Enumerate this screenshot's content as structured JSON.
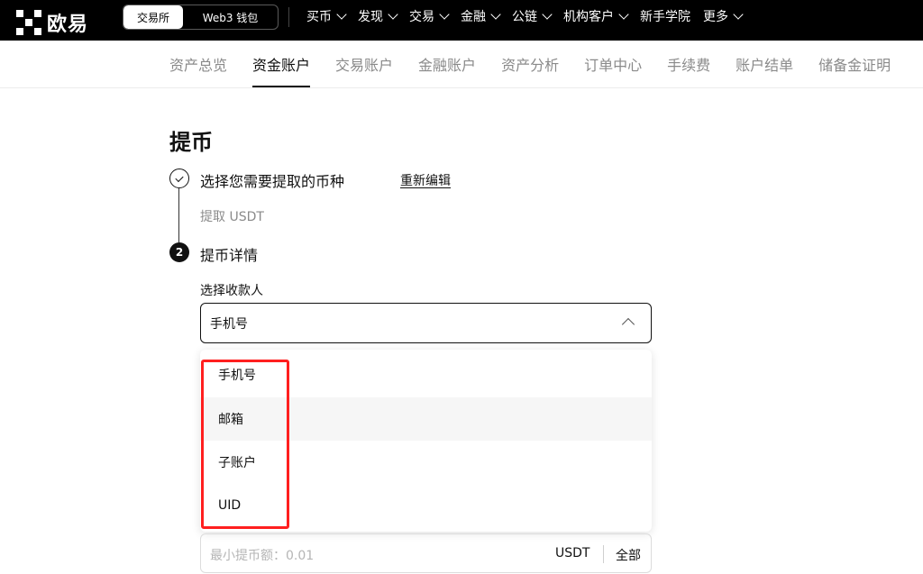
{
  "header": {
    "logo_text": "欧易",
    "switch": {
      "active": "交易所",
      "inactive": "Web3 钱包"
    },
    "nav": [
      {
        "label": "买币",
        "dropdown": true
      },
      {
        "label": "发现",
        "dropdown": true
      },
      {
        "label": "交易",
        "dropdown": true
      },
      {
        "label": "金融",
        "dropdown": true
      },
      {
        "label": "公链",
        "dropdown": true
      },
      {
        "label": "机构客户",
        "dropdown": true
      },
      {
        "label": "新手学院",
        "dropdown": false
      },
      {
        "label": "更多",
        "dropdown": true
      }
    ]
  },
  "subnav": {
    "items": [
      "资产总览",
      "资金账户",
      "交易账户",
      "金融账户",
      "资产分析",
      "订单中心",
      "手续费",
      "账户结单",
      "储备金证明"
    ],
    "active_index": 1
  },
  "page": {
    "title": "提币",
    "step1": {
      "label": "选择您需要提取的币种",
      "edit": "重新编辑",
      "sub": "提取 USDT"
    },
    "step2": {
      "number": "2",
      "label": "提币详情"
    }
  },
  "payee": {
    "label": "选择收款人",
    "selected": "手机号",
    "options": [
      "手机号",
      "邮箱",
      "子账户",
      "UID"
    ],
    "hovered_index": 1
  },
  "amount": {
    "placeholder": "最小提币额：0.01",
    "unit": "USDT",
    "all_label": "全部"
  },
  "colors": {
    "accent": "#000000",
    "highlight": "#ff1f1f"
  }
}
